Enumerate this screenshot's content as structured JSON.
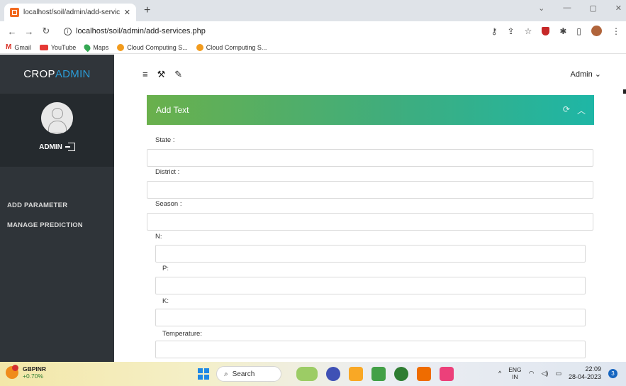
{
  "browser": {
    "tab_title": "localhost/soil/admin/add-service",
    "tab_close": "✕",
    "new_tab": "+",
    "url": "localhost/soil/admin/add-services.php",
    "bookmarks": [
      {
        "label": "Gmail"
      },
      {
        "label": "YouTube"
      },
      {
        "label": "Maps"
      },
      {
        "label": "Cloud Computing S..."
      },
      {
        "label": "Cloud Computing S..."
      }
    ]
  },
  "sidebar": {
    "brand_part1": "CROP",
    "brand_part2": "ADMIN",
    "profile_name": "ADMIN",
    "menu": [
      {
        "label": "ADD PARAMETER"
      },
      {
        "label": "MANAGE PREDICTION"
      }
    ]
  },
  "header": {
    "user_menu": "Admin ⌄"
  },
  "panel": {
    "title": "Add Text",
    "fields": [
      {
        "label": "State :",
        "value": ""
      },
      {
        "label": "District :",
        "value": ""
      },
      {
        "label": "Season :",
        "value": ""
      },
      {
        "label": "N:",
        "value": ""
      },
      {
        "label": "P:",
        "value": ""
      },
      {
        "label": "K:",
        "value": ""
      },
      {
        "label": "Temperature:",
        "value": ""
      }
    ]
  },
  "taskbar": {
    "ticker_symbol": "GBPINR",
    "ticker_change": "+0.70%",
    "search_label": "Search",
    "lang_line1": "ENG",
    "lang_line2": "IN",
    "time": "22:09",
    "date": "28-04-2023",
    "notifications": "3"
  },
  "colors": {
    "sidebar_bg": "#2f3439",
    "brand_accent": "#2b9bd6",
    "panel_gradient_start": "#6ab04c",
    "panel_gradient_end": "#1eb6a6"
  }
}
